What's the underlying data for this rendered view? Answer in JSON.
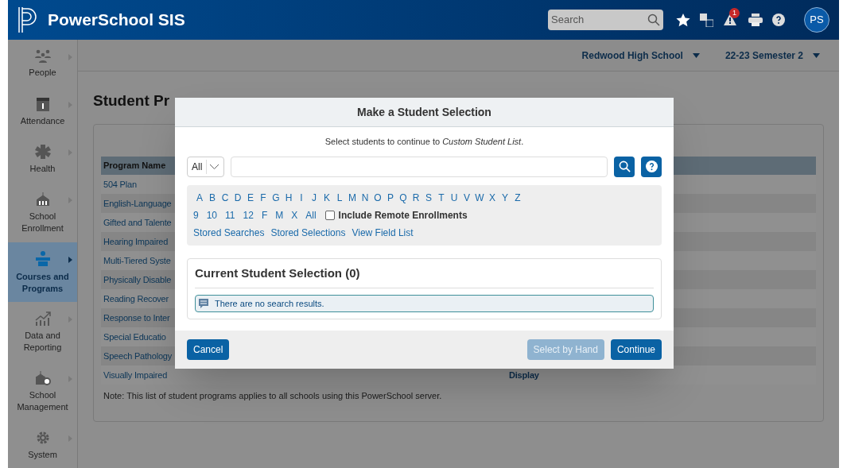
{
  "header": {
    "product": "PowerSchool SIS",
    "search": {
      "placeholder": "Search"
    },
    "alert_count": "1",
    "avatar": "PS"
  },
  "context": {
    "school": "Redwood High School",
    "term": "22-23 Semester 2"
  },
  "sidebar": {
    "items": [
      {
        "label": "People",
        "kind": "people",
        "selected": false
      },
      {
        "label": "Attendance",
        "kind": "attendance",
        "selected": false
      },
      {
        "label": "Health",
        "kind": "health",
        "selected": false
      },
      {
        "label": "School Enrollment",
        "kind": "enrollment",
        "selected": false
      },
      {
        "label": "Courses and Programs",
        "kind": "courses",
        "selected": true
      },
      {
        "label": "Data and Reporting",
        "kind": "data",
        "selected": false
      },
      {
        "label": "School Management",
        "kind": "management",
        "selected": false
      },
      {
        "label": "System",
        "kind": "system",
        "selected": false
      }
    ]
  },
  "page": {
    "title": "Student Pr",
    "table": {
      "columns": [
        "Program Name"
      ],
      "rows": [
        {
          "name": "504 Plan"
        },
        {
          "name": "English-Language"
        },
        {
          "name": "Gifted and Talente"
        },
        {
          "name": "Hearing Impaired"
        },
        {
          "name": "Multi-Tiered Syste"
        },
        {
          "name": "Physically Disable"
        },
        {
          "name": "Reading Recover"
        },
        {
          "name": "Response to Inter"
        },
        {
          "name": "Special Educatio"
        },
        {
          "name": "Speech Pathology"
        },
        {
          "name": "Visually Impaired",
          "column_2": "Display"
        }
      ]
    },
    "note": "Note: This list of student programs applies to all schools using this PowerSchool server."
  },
  "modal": {
    "title": "Make a Student Selection",
    "subtitle": "Select students to continue to *Custom Student List*.",
    "filter_select": "All",
    "letters": [
      "A",
      "B",
      "C",
      "D",
      "E",
      "F",
      "G",
      "H",
      "I",
      "J",
      "K",
      "L",
      "M",
      "N",
      "O",
      "P",
      "Q",
      "R",
      "S",
      "T",
      "U",
      "V",
      "W",
      "X",
      "Y",
      "Z"
    ],
    "grades": [
      "9",
      "10",
      "11",
      "12",
      "F",
      "M",
      "X",
      "All"
    ],
    "remote_checkbox": {
      "label": "Include Remote Enrollments",
      "checked": false
    },
    "links": [
      "Stored Searches",
      "Stored Selections",
      "View Field List"
    ],
    "selection": {
      "title": "Current Student Selection (0)",
      "message": "There are no search results."
    },
    "buttons": [
      {
        "label": "Cancel",
        "disabled": false
      },
      {
        "label": "Select by Hand",
        "disabled": true
      },
      {
        "label": "Continue",
        "disabled": false
      }
    ]
  }
}
